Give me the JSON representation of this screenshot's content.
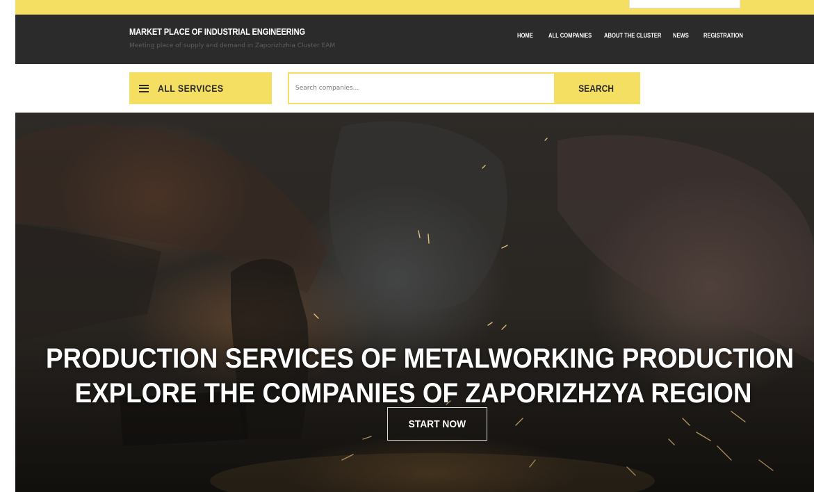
{
  "header": {
    "brand_title": "MARKET PLACE OF INDUSTRIAL ENGINEERING",
    "brand_subtitle": "Meeting place of supply and demand in Zaporizhzhia Cluster EAM",
    "nav": [
      {
        "label": "HOME"
      },
      {
        "label": "ALL COMPANIES"
      },
      {
        "label": "ABOUT THE CLUSTER"
      },
      {
        "label": "NEWS"
      },
      {
        "label": "REGISTRATION"
      }
    ]
  },
  "toolbar": {
    "services_label": "ALL SERVICES",
    "services_icon": "hamburger-icon",
    "search_placeholder": "Search companies...",
    "search_value": "",
    "search_button_label": "SEARCH"
  },
  "hero": {
    "line1": "PRODUCTION SERVICES OF METALWORKING PRODUCTION",
    "line2": "EXPLORE THE COMPANIES OF ZAPORIZHZYA REGION",
    "cta_label": "START NOW"
  },
  "colors": {
    "accent": "#f4df62",
    "header_bg": "#2b2b2b",
    "text_dark": "#2b2b2b",
    "text_light": "#ffffff"
  }
}
